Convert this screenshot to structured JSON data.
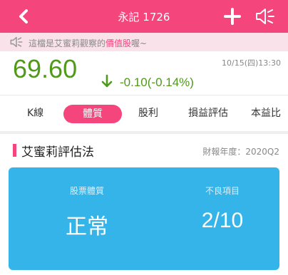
{
  "header": {
    "title": "永記 1726"
  },
  "notice": {
    "prefix": "這檔是艾蜜莉觀察的",
    "highlight": "價值股",
    "suffix": "喔~"
  },
  "quote": {
    "price": "69.60",
    "change": "-0.10(-0.14%)",
    "timestamp": "10/15(四)13:30"
  },
  "tabs": [
    {
      "label": "K線",
      "active": false
    },
    {
      "label": "體質",
      "active": true
    },
    {
      "label": "股利",
      "active": false
    },
    {
      "label": "損益評估",
      "active": false
    },
    {
      "label": "本益比",
      "active": false
    }
  ],
  "section": {
    "title": "艾蜜莉評估法",
    "fiscal_year": "財報年度：2020Q2"
  },
  "card": {
    "left_label": "股票體質",
    "left_value": "正常",
    "right_label": "不良項目",
    "right_value": "2/10"
  },
  "colors": {
    "brand": "#f5457d",
    "price_down": "#4f9a1a",
    "card_bg": "#34b4e8"
  }
}
